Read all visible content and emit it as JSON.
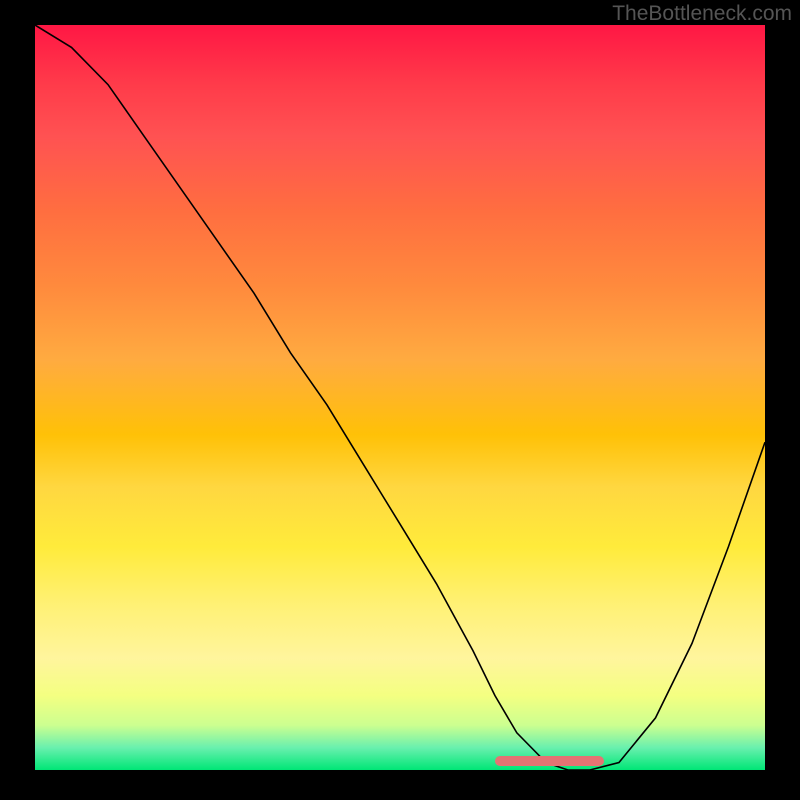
{
  "watermark": "TheBottleneck.com",
  "chart_data": {
    "type": "line",
    "title": "",
    "xlabel": "",
    "ylabel": "",
    "xlim": [
      0,
      100
    ],
    "ylim": [
      0,
      100
    ],
    "series": [
      {
        "name": "curve",
        "x": [
          0,
          5,
          10,
          15,
          20,
          25,
          30,
          35,
          40,
          45,
          50,
          55,
          60,
          63,
          66,
          70,
          73,
          76,
          80,
          85,
          90,
          95,
          100
        ],
        "values": [
          100,
          97,
          92,
          85,
          78,
          71,
          64,
          56,
          49,
          41,
          33,
          25,
          16,
          10,
          5,
          1,
          0,
          0,
          1,
          7,
          17,
          30,
          44
        ]
      }
    ],
    "highlight_band": {
      "x_start": 63,
      "x_end": 78,
      "color": "#e57373"
    },
    "gradient": "vertical red-yellow-green"
  }
}
